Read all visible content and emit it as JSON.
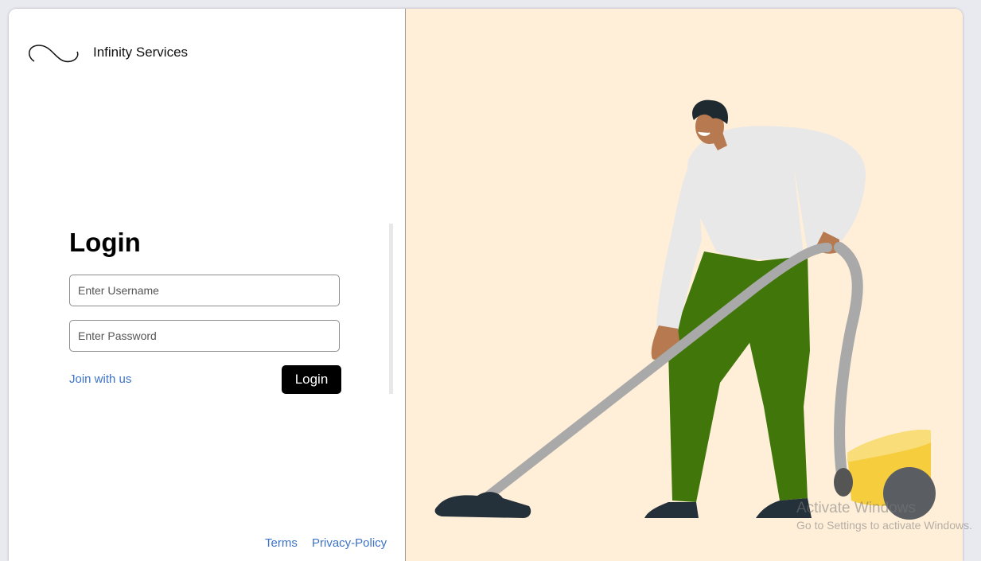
{
  "brand": {
    "name": "Infinity Services"
  },
  "login": {
    "title": "Login",
    "username_placeholder": "Enter Username",
    "password_placeholder": "Enter Password",
    "join_label": "Join with us",
    "submit_label": "Login"
  },
  "footer": {
    "terms": "Terms",
    "privacy": "Privacy-Policy"
  },
  "watermark": {
    "title": "Activate Windows",
    "subtitle": "Go to Settings to activate Windows."
  },
  "illustration": {
    "subject": "person-vacuuming-icon"
  },
  "colors": {
    "accent_link": "#3d73c9",
    "button_bg": "#000000",
    "panel_bg": "#ffefd9",
    "pants": "#41760a",
    "vacuum_body": "#f6cd3d"
  }
}
